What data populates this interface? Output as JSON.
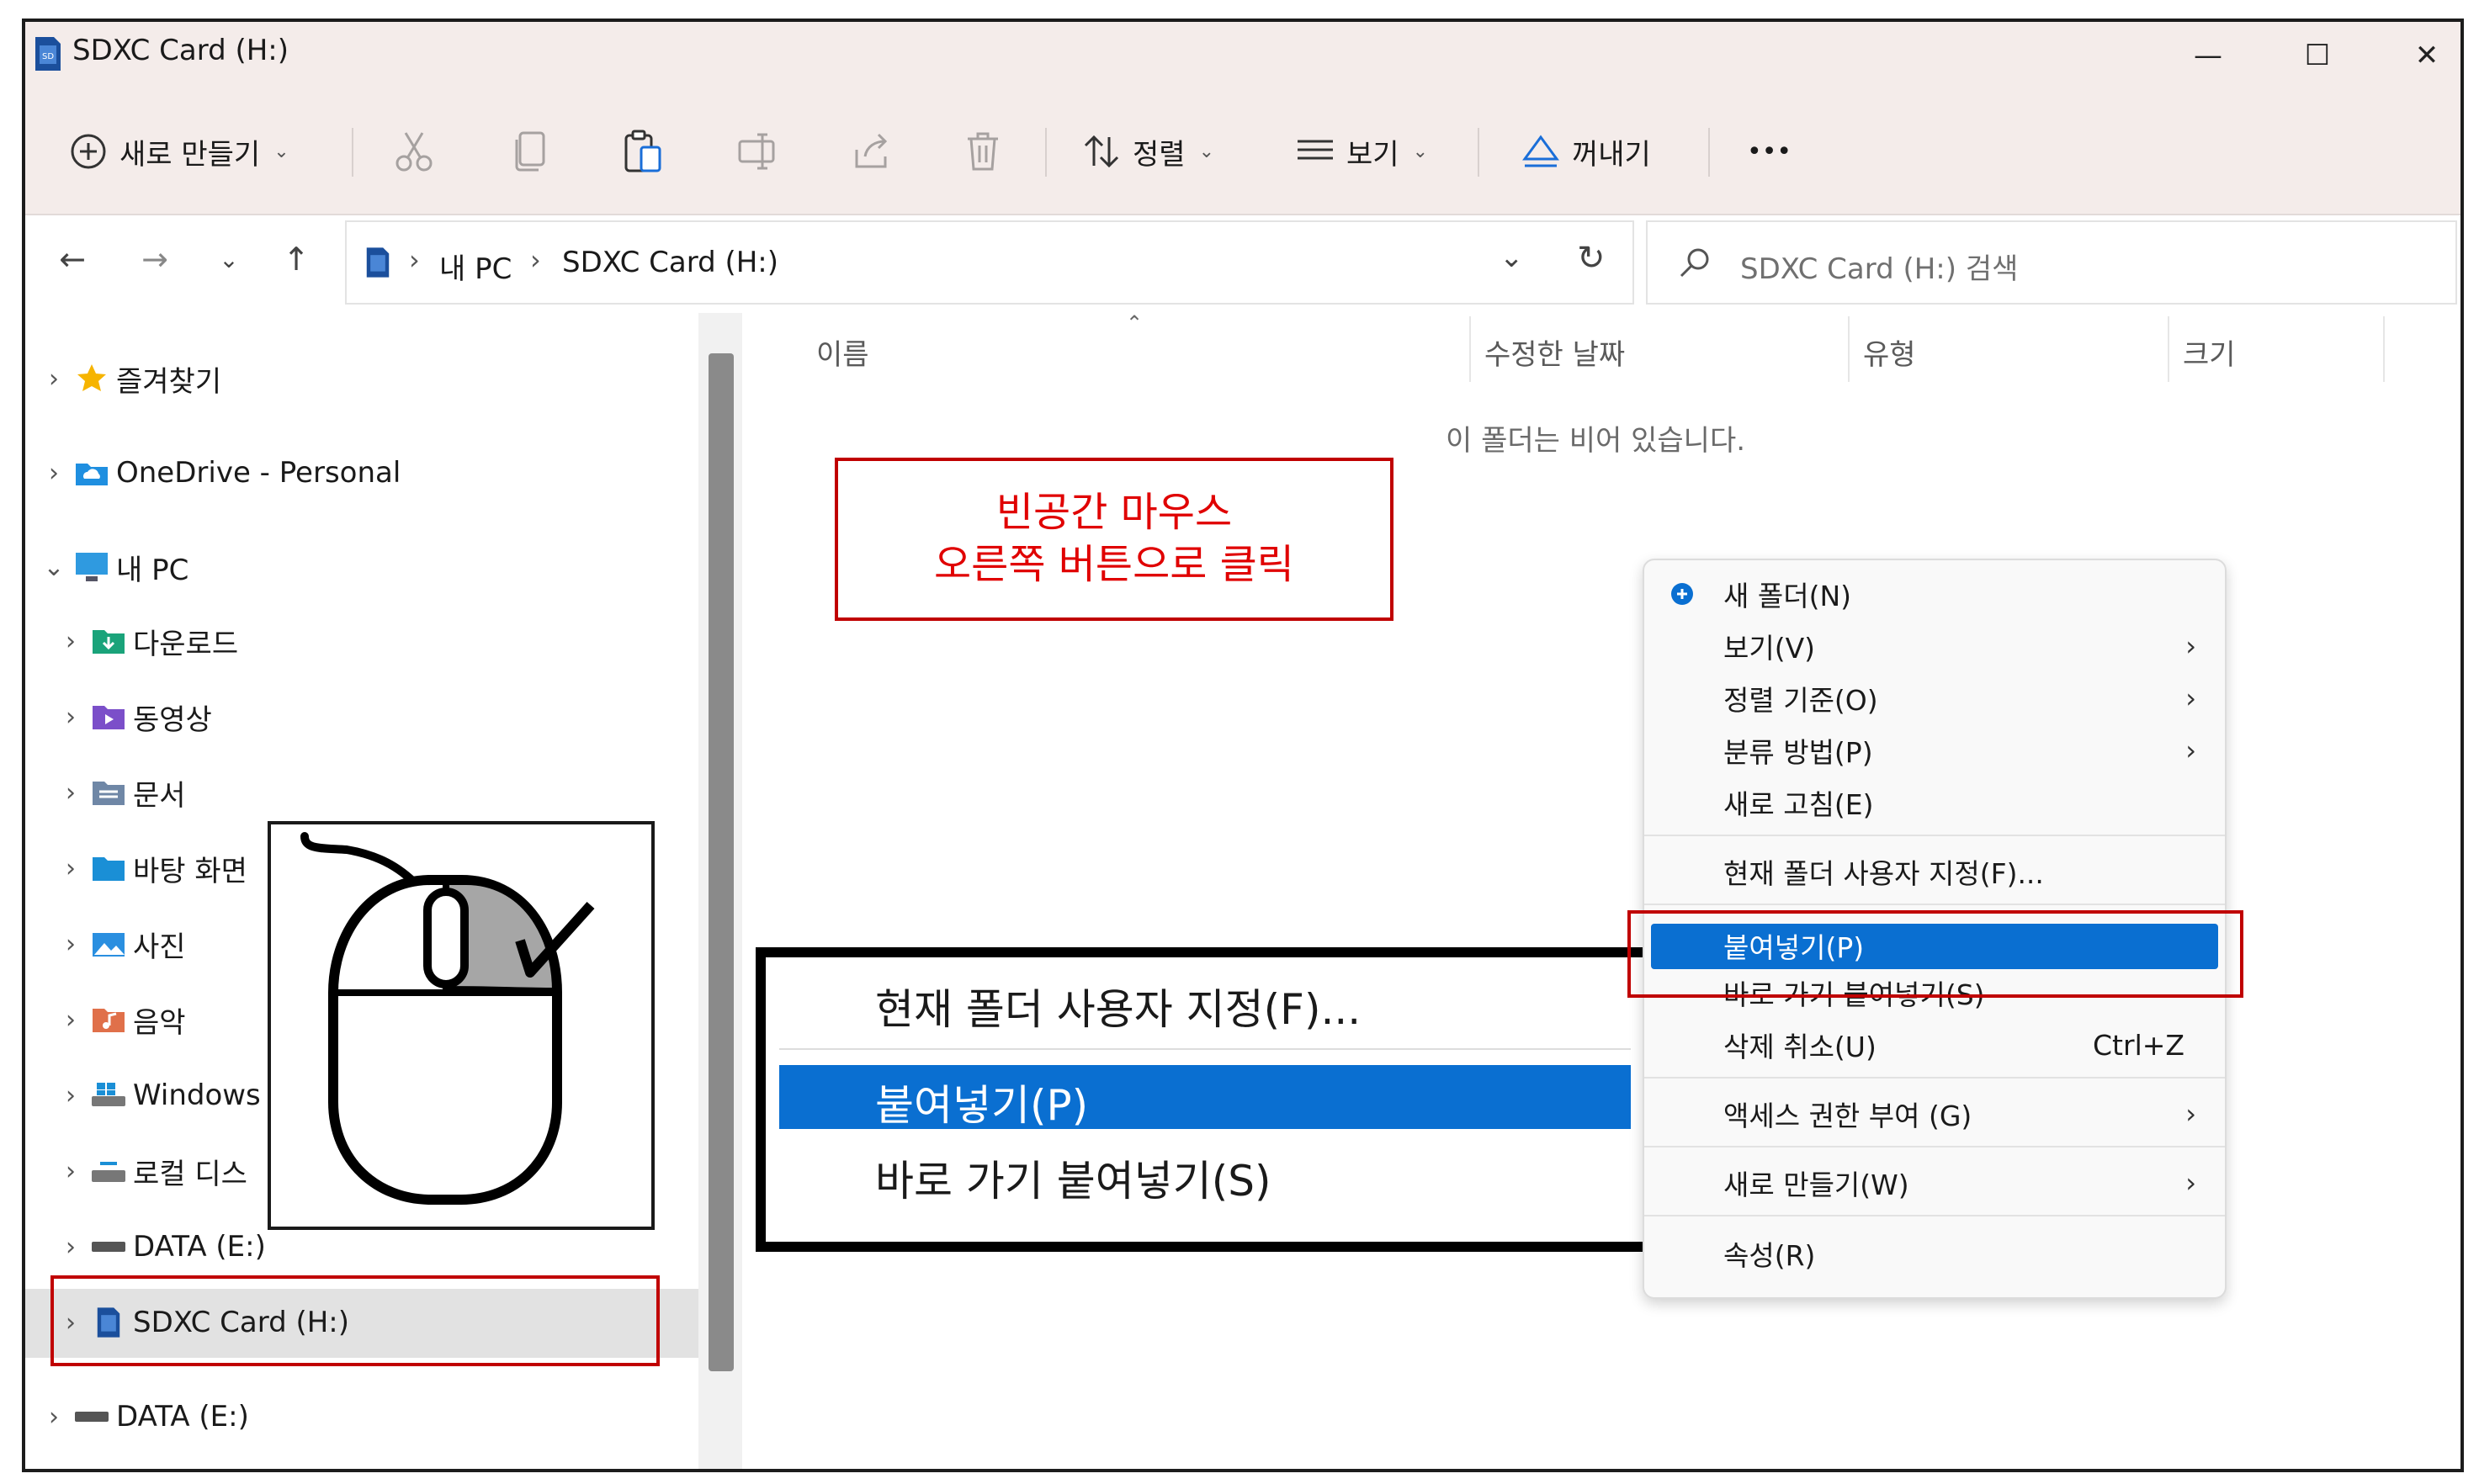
{
  "window": {
    "title": "SDXC Card (H:)",
    "controls": {
      "minimize": "—",
      "maximize": "☐",
      "close": "✕"
    }
  },
  "toolbar": {
    "new_label": "새로 만들기",
    "sort_label": "정렬",
    "view_label": "보기",
    "eject_label": "꺼내기",
    "more_label": "•••",
    "icons": [
      "cut-icon",
      "copy-icon",
      "paste-icon",
      "rename-icon",
      "share-icon",
      "delete-icon"
    ]
  },
  "address": {
    "crumbs": [
      "내 PC",
      "SDXC Card (H:)"
    ],
    "search_placeholder": "SDXC Card (H:) 검색"
  },
  "nav": {
    "items": [
      {
        "label": "즐겨찾기"
      },
      {
        "label": "OneDrive - Personal"
      },
      {
        "label": "내 PC"
      },
      {
        "label": "다운로드"
      },
      {
        "label": "동영상"
      },
      {
        "label": "문서"
      },
      {
        "label": "바탕 화면"
      },
      {
        "label": "사진"
      },
      {
        "label": "음악"
      },
      {
        "label": "Windows"
      },
      {
        "label": "로컬 디스"
      },
      {
        "label": "DATA (E:)"
      },
      {
        "label": "SDXC Card (H:)"
      },
      {
        "label": "DATA (E:)"
      }
    ]
  },
  "content": {
    "columns": [
      "이름",
      "수정한 날짜",
      "유형",
      "크기"
    ],
    "empty_message": "이 폴더는 비어 있습니다."
  },
  "annotation": {
    "line1": "빈공간 마우스",
    "line2": "오른쪽 버튼으로 클릭",
    "color": "#e00000"
  },
  "context_menu": {
    "items": [
      {
        "label": "새 폴더(N)"
      },
      {
        "label": "보기(V)"
      },
      {
        "label": "정렬 기준(O)"
      },
      {
        "label": "분류 방법(P)"
      },
      {
        "label": "새로 고침(E)"
      },
      {
        "label": "현재 폴더 사용자 지정(F)..."
      },
      {
        "label": "붙여넣기(P)"
      },
      {
        "label": "바로 가기 붙여넣기(S)"
      },
      {
        "label": "삭제 취소(U)",
        "shortcut": "Ctrl+Z"
      },
      {
        "label": "액세스 권한 부여 (G)"
      },
      {
        "label": "새로 만들기(W)"
      },
      {
        "label": "속성(R)"
      }
    ],
    "highlight_color": "#0a6fd1"
  },
  "zoom_callout": {
    "items": [
      "현재 폴더 사용자 지정(F)...",
      "붙여넣기(P)",
      "바로 가기 붙여넣기(S)"
    ]
  }
}
